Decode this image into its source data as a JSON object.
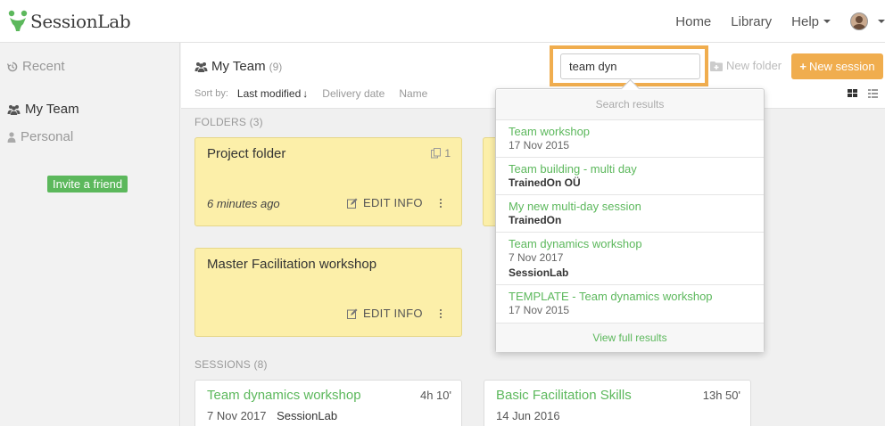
{
  "header": {
    "logo_text": "SessionLab",
    "nav": {
      "home": "Home",
      "library": "Library",
      "help": "Help"
    }
  },
  "sidebar": {
    "recent": "Recent",
    "my_team": "My Team",
    "personal": "Personal",
    "invite": "Invite a friend"
  },
  "toolbar": {
    "team_title": "My Team",
    "team_count": "(9)",
    "sort_label": "Sort by:",
    "sort_options": [
      "Last modified",
      "Delivery date",
      "Name"
    ],
    "search_value": "team dyn",
    "new_folder": "New folder",
    "new_session": "New session"
  },
  "folders": {
    "label": "FOLDERS (3)",
    "items": [
      {
        "title": "Project folder",
        "copies": "1",
        "time": "6 minutes ago",
        "edit": "EDIT INFO"
      },
      {
        "title": "Master Facilitation workshop",
        "edit": "EDIT INFO"
      }
    ]
  },
  "sessions": {
    "label": "SESSIONS (8)",
    "items": [
      {
        "title": "Team dynamics workshop",
        "duration": "4h 10'",
        "date": "7 Nov 2017",
        "org": "SessionLab"
      },
      {
        "title": "Basic Facilitation Skills",
        "duration": "13h 50'",
        "date": "14 Jun 2016"
      }
    ]
  },
  "search_results": {
    "header": "Search results",
    "items": [
      {
        "title": "Team workshop",
        "date": "17 Nov 2015"
      },
      {
        "title": "Team building - multi day",
        "org": "TrainedOn OÜ"
      },
      {
        "title": "My new multi-day session",
        "org": "TrainedOn"
      },
      {
        "title": "Team dynamics workshop",
        "date": "7 Nov 2017",
        "org": "SessionLab"
      },
      {
        "title": "TEMPLATE - Team dynamics workshop",
        "date": "17 Nov 2015"
      }
    ],
    "footer": "View full results"
  },
  "colors": {
    "accent_green": "#5cb85c",
    "accent_orange": "#f0ad4e",
    "folder_yellow": "#fcefa9"
  }
}
